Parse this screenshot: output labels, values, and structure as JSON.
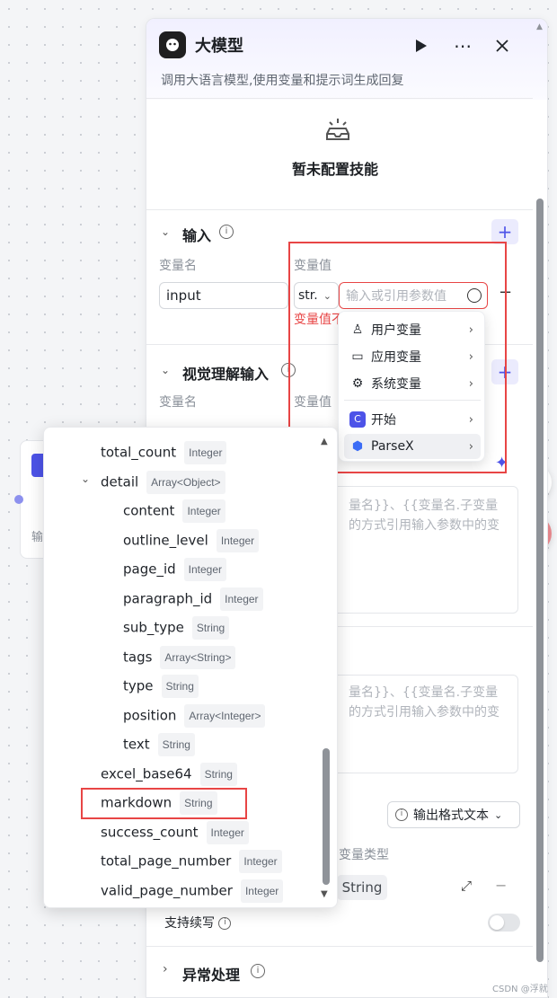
{
  "panel": {
    "title": "大模型",
    "description": "调用大语言模型,使用变量和提示词生成回复",
    "no_skill_text": "暂未配置技能"
  },
  "input_section": {
    "title": "输入",
    "col_name": "变量名",
    "col_value": "变量值",
    "var_name_value": "input",
    "type_short": "str.",
    "value_placeholder": "输入或引用参数值",
    "error_text": "变量值不"
  },
  "visual_section": {
    "title": "视觉理解输入",
    "col_name": "变量名",
    "col_value": "变量值"
  },
  "prompt": {
    "hint1_line1": "量名}}、{{变量名.子变量",
    "hint1_line2": "的方式引用输入参数中的变",
    "hint2_line1": "量名}}、{{变量名.子变量",
    "hint2_line2": "的方式引用输入参数中的变"
  },
  "output": {
    "format_label": "输出格式文本",
    "col_type": "变量类型",
    "type_value": "String",
    "continue_label": "支持续写"
  },
  "exception": {
    "title": "异常处理"
  },
  "node_left": {
    "text": "输"
  },
  "var_menu": {
    "items": [
      {
        "label": "用户变量",
        "icon": "person-icon"
      },
      {
        "label": "应用变量",
        "icon": "folder-icon"
      },
      {
        "label": "系统变量",
        "icon": "gear-icon"
      },
      {
        "label": "开始",
        "icon": "start-icon"
      },
      {
        "label": "ParseX",
        "icon": "parsex-icon"
      }
    ]
  },
  "tree": {
    "items": [
      {
        "label": "total_count",
        "type": "Integer",
        "level": 1
      },
      {
        "label": "detail",
        "type": "Array<Object>",
        "level": 1,
        "expanded": true
      },
      {
        "label": "content",
        "type": "Integer",
        "level": 2
      },
      {
        "label": "outline_level",
        "type": "Integer",
        "level": 2
      },
      {
        "label": "page_id",
        "type": "Integer",
        "level": 2
      },
      {
        "label": "paragraph_id",
        "type": "Integer",
        "level": 2
      },
      {
        "label": "sub_type",
        "type": "String",
        "level": 2
      },
      {
        "label": "tags",
        "type": "Array<String>",
        "level": 2
      },
      {
        "label": "type",
        "type": "String",
        "level": 2
      },
      {
        "label": "position",
        "type": "Array<Integer>",
        "level": 2
      },
      {
        "label": "text",
        "type": "String",
        "level": 2
      },
      {
        "label": "excel_base64",
        "type": "String",
        "level": 1
      },
      {
        "label": "markdown",
        "type": "String",
        "level": 1,
        "highlighted": true
      },
      {
        "label": "success_count",
        "type": "Integer",
        "level": 1
      },
      {
        "label": "total_page_number",
        "type": "Integer",
        "level": 1
      },
      {
        "label": "valid_page_number",
        "type": "Integer",
        "level": 1
      }
    ]
  },
  "watermark": "CSDN @浮就",
  "colors": {
    "accent": "#4d53e8",
    "error": "#e84545",
    "menu_selected": "#eff0f3"
  }
}
